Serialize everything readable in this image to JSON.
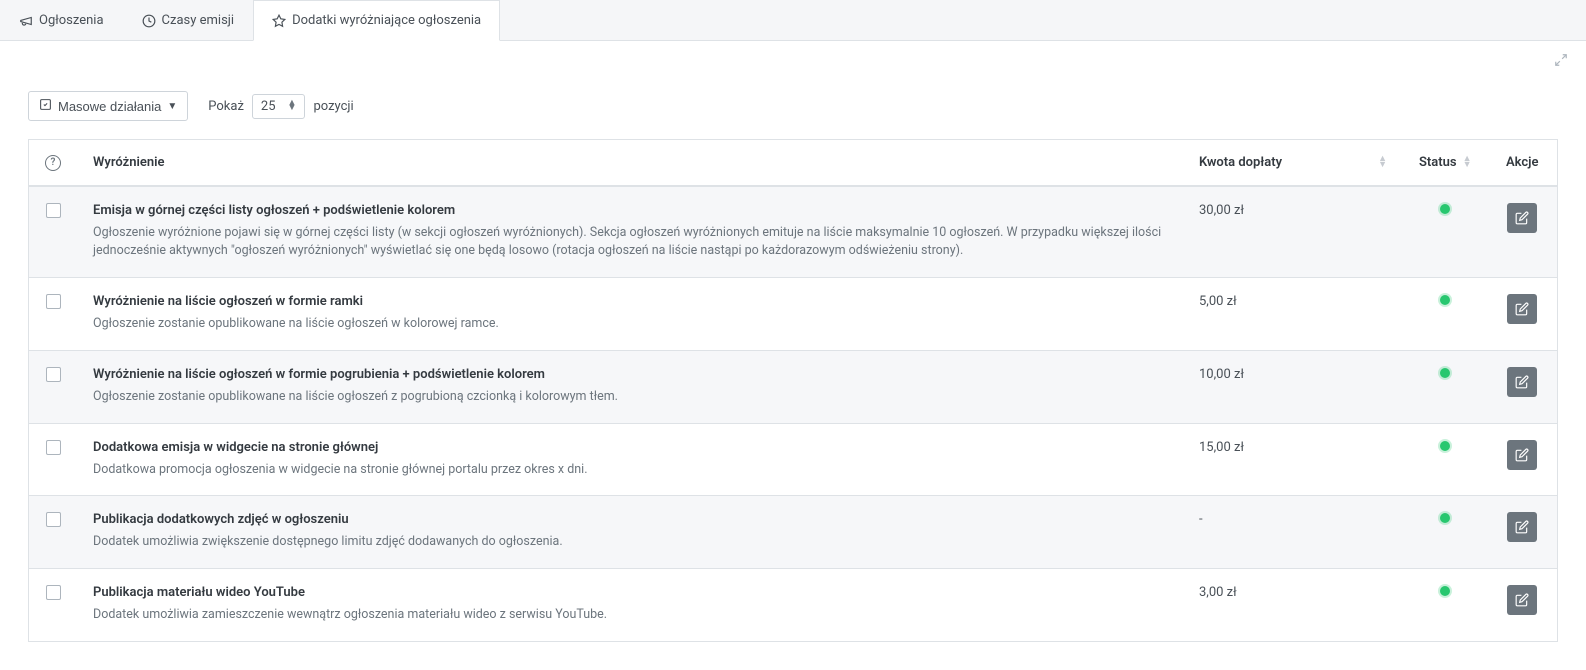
{
  "tabs": [
    {
      "label": "Ogłoszenia",
      "icon": "megaphone-icon"
    },
    {
      "label": "Czasy emisji",
      "icon": "clock-icon"
    },
    {
      "label": "Dodatki wyróżniające ogłoszenia",
      "icon": "star-icon"
    }
  ],
  "toolbar": {
    "bulk_actions_label": "Masowe działania",
    "show_label": "Pokaż",
    "entries_label": "pozycji",
    "page_size": "25"
  },
  "table": {
    "headers": {
      "highlight": "Wyróżnienie",
      "amount": "Kwota dopłaty",
      "status": "Status",
      "actions": "Akcje"
    },
    "rows": [
      {
        "title": "Emisja w górnej części listy ogłoszeń + podświetlenie kolorem",
        "description": "Ogłoszenie wyróżnione pojawi się w górnej części listy (w sekcji ogłoszeń wyróżnionych). Sekcja ogłoszeń wyróżnionych emituje na liście maksymalnie 10 ogłoszeń. W przypadku większej ilości jednocześnie aktywnych \"ogłoszeń wyróżnionych\" wyświetlać się one będą losowo (rotacja ogłoszeń na liście nastąpi po każdorazowym odświeżeniu strony).",
        "amount": "30,00 zł",
        "status": "active"
      },
      {
        "title": "Wyróżnienie na liście ogłoszeń w formie ramki",
        "description": "Ogłoszenie zostanie opublikowane na liście ogłoszeń w kolorowej ramce.",
        "amount": "5,00 zł",
        "status": "active"
      },
      {
        "title": "Wyróżnienie na liście ogłoszeń w formie pogrubienia + podświetlenie kolorem",
        "description": "Ogłoszenie zostanie opublikowane na liście ogłoszeń z pogrubioną czcionką i kolorowym tłem.",
        "amount": "10,00 zł",
        "status": "active"
      },
      {
        "title": "Dodatkowa emisja w widgecie na stronie głównej",
        "description": "Dodatkowa promocja ogłoszenia w widgecie na stronie głównej portalu przez okres x dni.",
        "amount": "15,00 zł",
        "status": "active"
      },
      {
        "title": "Publikacja dodatkowych zdjęć w ogłoszeniu",
        "description": "Dodatek umożliwia zwiększenie dostępnego limitu zdjęć dodawanych do ogłoszenia.",
        "amount": "-",
        "status": "active"
      },
      {
        "title": "Publikacja materiału wideo YouTube",
        "description": "Dodatek umożliwia zamieszczenie wewnątrz ogłoszenia materiału wideo z serwisu YouTube.",
        "amount": "3,00 zł",
        "status": "active"
      }
    ]
  }
}
